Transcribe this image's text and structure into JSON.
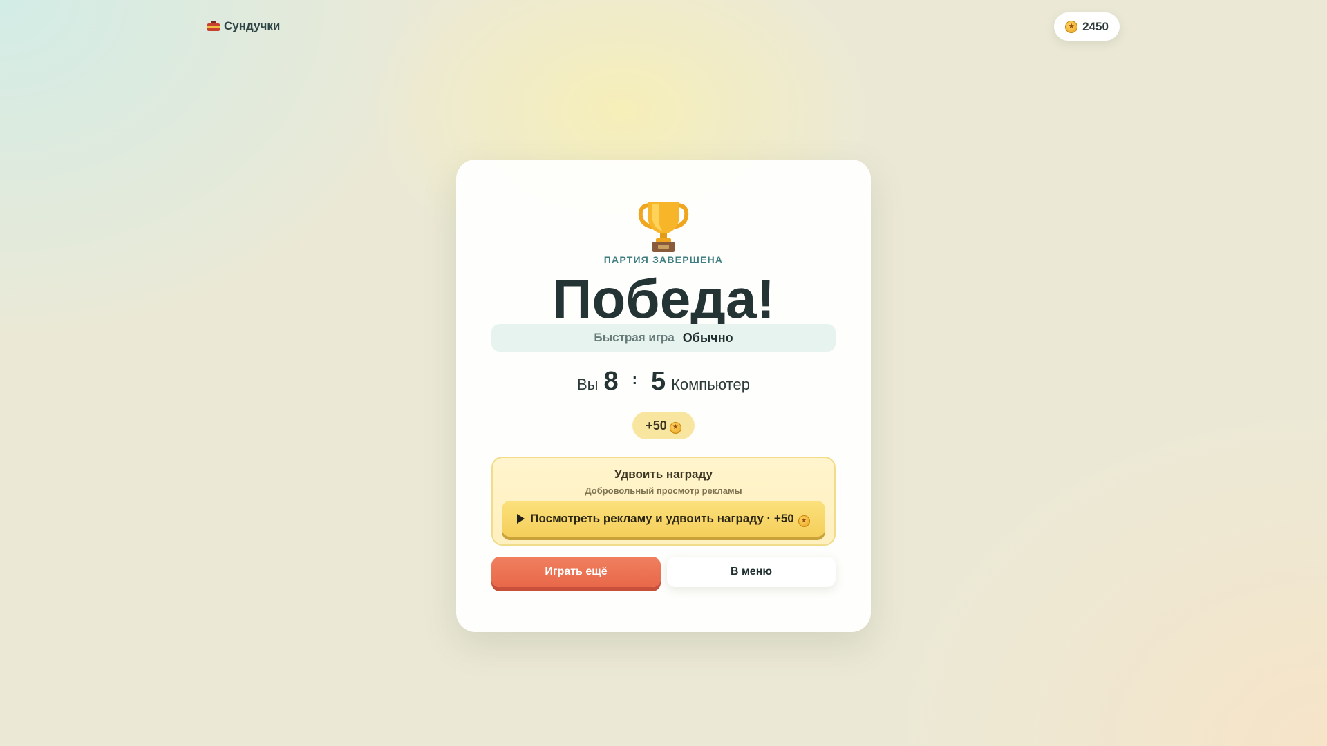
{
  "brand": {
    "name": "Сундучки",
    "icon": "chest-icon"
  },
  "wallet": {
    "coins": "2450",
    "icon": "coin-icon"
  },
  "result": {
    "icon": "trophy-icon",
    "kicker": "ПАРТИЯ ЗАВЕРШЕНА",
    "title": "Победа!",
    "mode_name": "Быстрая игра",
    "mode_difficulty": "Обычно",
    "player_label": "Вы",
    "player_score": "8",
    "separator": ":",
    "opponent_score": "5",
    "opponent_label": "Компьютер",
    "reward": "+50"
  },
  "double_reward": {
    "title": "Удвоить награду",
    "subtitle": "Добровольный просмотр рекламы",
    "button_label": "Посмотреть рекламу и удвоить награду · +50",
    "button_icon": "play-icon"
  },
  "actions": {
    "play_again": "Играть ещё",
    "menu": "В меню"
  },
  "colors": {
    "primary": "#e86849",
    "accent_gold": "#f5cf5a",
    "teal_text": "#3f7e80",
    "dark_text": "#243434"
  }
}
